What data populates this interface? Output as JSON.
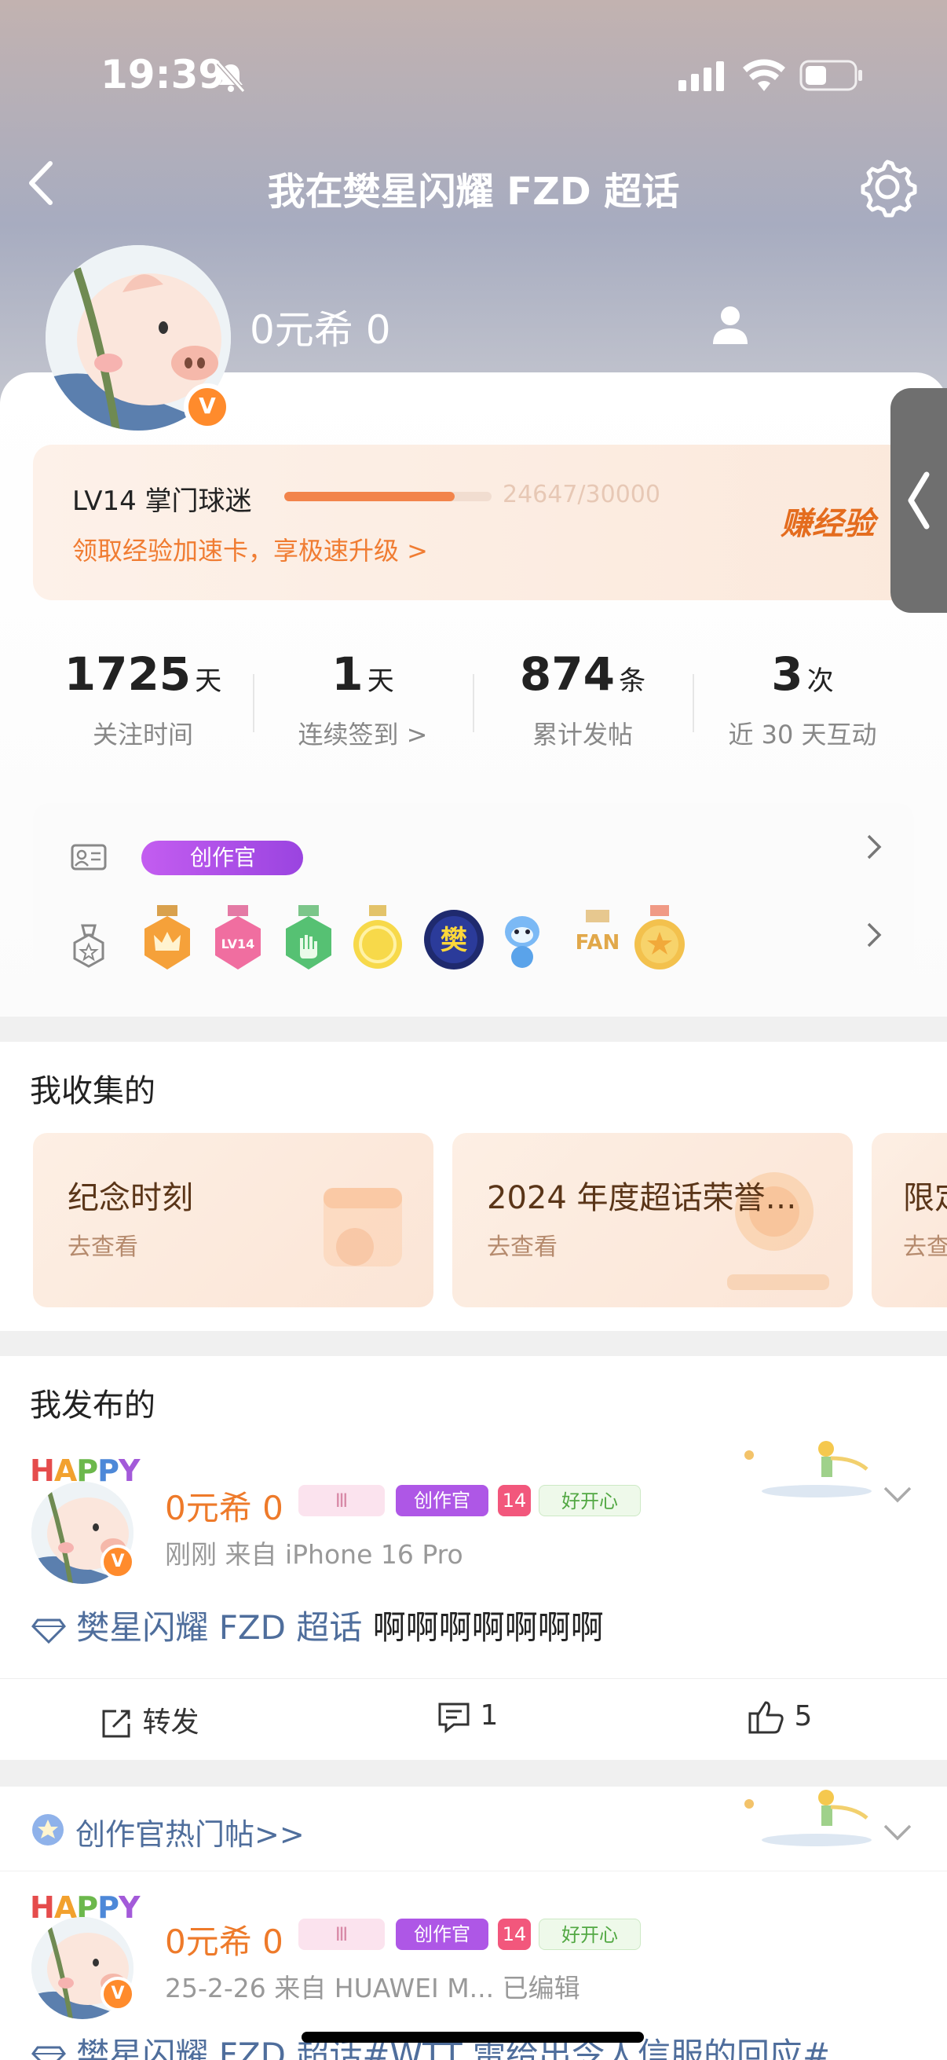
{
  "status_bar": {
    "time": "19:39"
  },
  "nav": {
    "title": "我在樊星闪耀 FZD 超话"
  },
  "profile": {
    "username": "0元希 0",
    "verified_mark": "V"
  },
  "level": {
    "label": "LV14 掌门球迷",
    "progress_text": "24647/30000",
    "progress": 0.8216,
    "subtitle": "领取经验加速卡，享极速升级 >",
    "earn_label": "赚经验"
  },
  "stats": [
    {
      "value": "1725",
      "unit": "天",
      "label": "关注时间"
    },
    {
      "value": "1",
      "unit": "天",
      "label": "连续签到 >"
    },
    {
      "value": "874",
      "unit": "条",
      "label": "累计发帖"
    },
    {
      "value": "3",
      "unit": "次",
      "label": "近 30 天互动"
    }
  ],
  "badges": {
    "creator_label": "创作官",
    "medal_icons": [
      "crown-medal",
      "lv-medal",
      "hand-medal",
      "gold-medal",
      "fan-medal",
      "mascot-medal",
      "fan-text-medal",
      "star-medal"
    ]
  },
  "collected": {
    "heading": "我收集的",
    "cards": [
      {
        "title": "纪念时刻",
        "sub": "去查看"
      },
      {
        "title": "2024 年度超话荣誉…",
        "sub": "去查看"
      },
      {
        "title": "限定",
        "sub": "去查看"
      }
    ]
  },
  "published": {
    "heading": "我发布的",
    "post1": {
      "author": "0元希 0",
      "happy": "HAPPY",
      "tag_creator": "创作官",
      "tag_mood": "好开心",
      "tag_level": "14",
      "meta": "刚刚  来自 iPhone 16 Pro",
      "topic": "樊星闪耀 FZD 超话",
      "text": "啊啊啊啊啊啊啊",
      "repost_label": "转发",
      "comment_count": "1",
      "like_count": "5"
    },
    "hot_label": "创作官热门帖>>",
    "post2": {
      "author": "0元希 0",
      "happy": "HAPPY",
      "tag_creator": "创作官",
      "tag_mood": "好开心",
      "tag_level": "14",
      "meta": "25-2-26  来自 HUAWEI M...  已编辑",
      "text": "樊星闪耀 FZD 超话#WTT 雷给出令人信服的回应#"
    }
  },
  "colors": {
    "accent": "#f07c32",
    "link": "#4f6e9c",
    "creator": "#a84ee6"
  }
}
